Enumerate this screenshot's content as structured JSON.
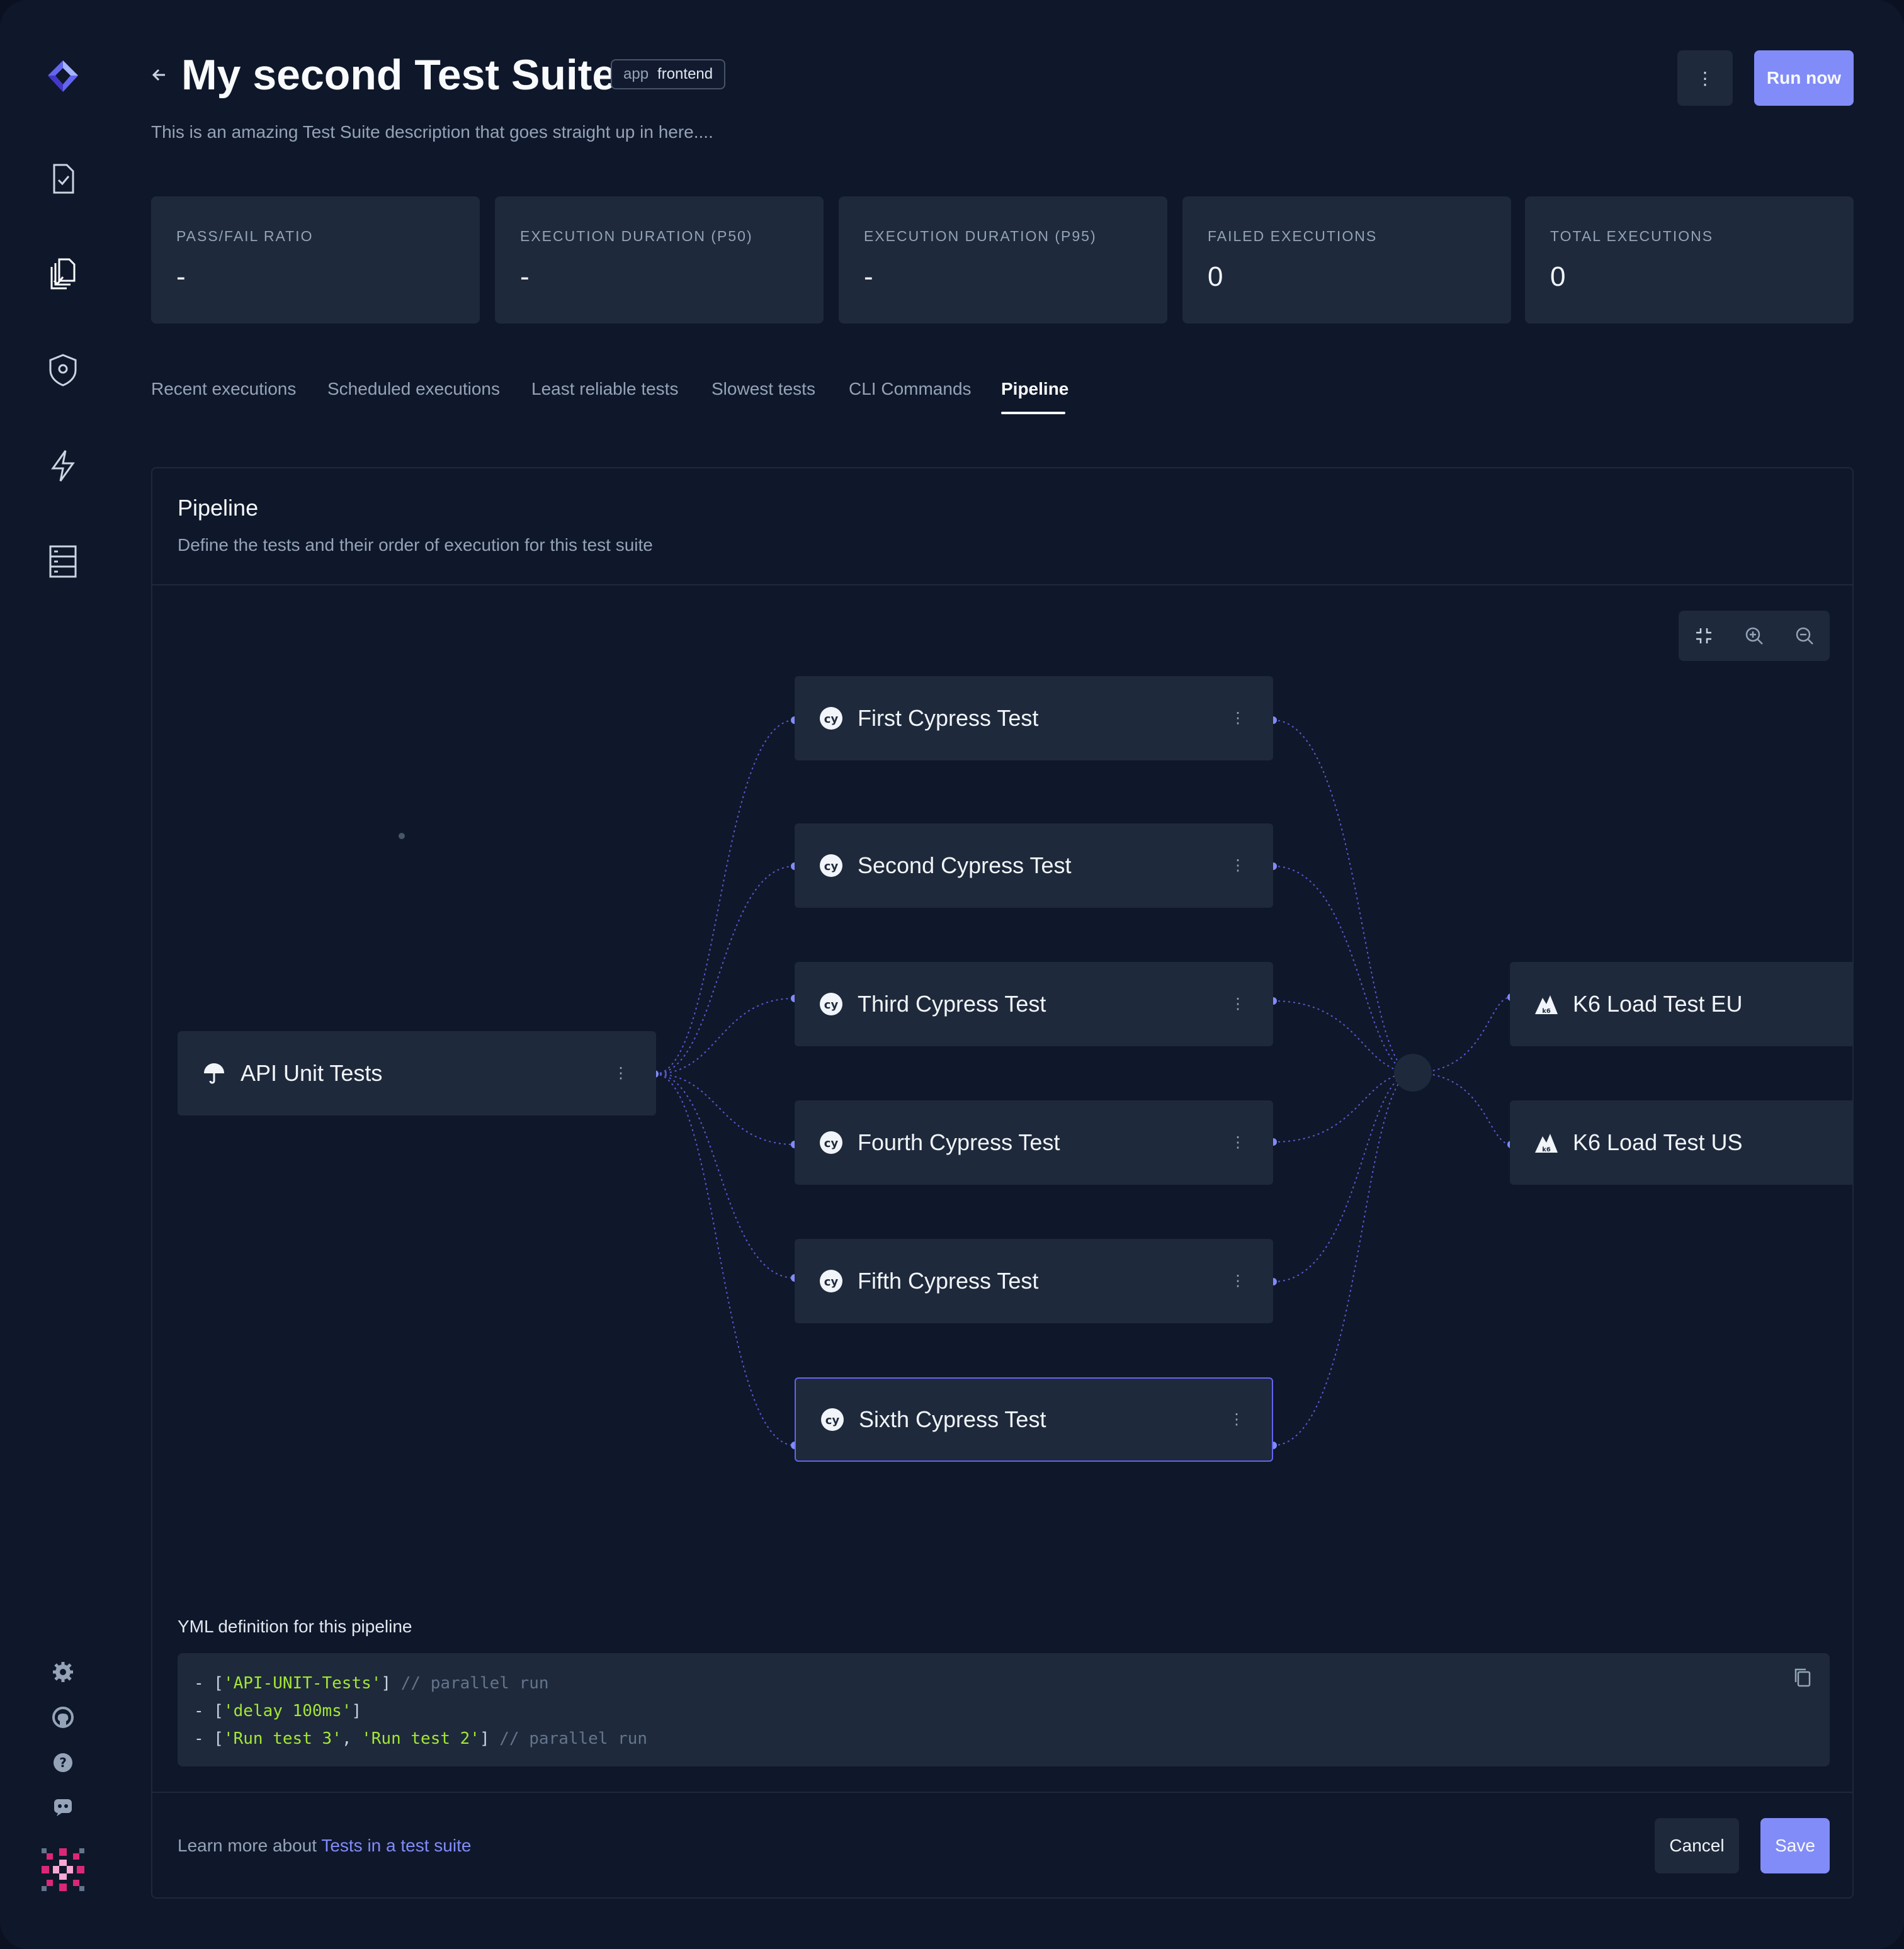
{
  "header": {
    "title": "My second Test Suite",
    "label_key": "app",
    "label_value": "frontend",
    "description": "This is an amazing Test Suite description that goes straight up in here....",
    "more_label": "⋮",
    "run_label": "Run now"
  },
  "stats": [
    {
      "label": "PASS/FAIL RATIO",
      "value": "-"
    },
    {
      "label": "EXECUTION DURATION (P50)",
      "value": "-"
    },
    {
      "label": "EXECUTION DURATION (P95)",
      "value": "-"
    },
    {
      "label": "FAILED EXECUTIONS",
      "value": "0"
    },
    {
      "label": "TOTAL EXECUTIONS",
      "value": "0"
    }
  ],
  "tabs": [
    {
      "label": "Recent executions"
    },
    {
      "label": "Scheduled executions"
    },
    {
      "label": "Least reliable tests"
    },
    {
      "label": "Slowest tests"
    },
    {
      "label": "CLI Commands"
    },
    {
      "label": "Pipeline",
      "active": true
    }
  ],
  "pipeline": {
    "title": "Pipeline",
    "subtitle": "Define the tests and their order of execution for this test suite",
    "nodes": {
      "api": "API Unit Tests",
      "c1": "First Cypress Test",
      "c2": "Second Cypress Test",
      "c3": "Third Cypress Test",
      "c4": "Fourth Cypress Test",
      "c5": "Fifth Cypress Test",
      "c6": "Sixth Cypress Test",
      "k6eu": "K6 Load Test EU",
      "k6us": "K6 Load Test US"
    },
    "node_menu": "⋮"
  },
  "yml": {
    "label": "YML definition for this pipeline",
    "lines": [
      {
        "prefix": "- [",
        "str": "'API-UNIT-Tests'",
        "suffix": "] ",
        "comment": "// parallel run"
      },
      {
        "prefix": "- [",
        "str": "'delay 100ms'",
        "suffix": "]",
        "comment": ""
      },
      {
        "prefix": "- [",
        "str": "'Run test 3'",
        "mid": ", ",
        "str2": "'Run test 2'",
        "suffix": "] ",
        "comment": "// parallel run"
      }
    ]
  },
  "footer": {
    "learn_prefix": "Learn more about ",
    "learn_link": "Tests in a test suite",
    "cancel_label": "Cancel",
    "save_label": "Save"
  },
  "colors": {
    "background": "#0f172a",
    "surface": "#1e293b",
    "accent": "#818cf8",
    "edge": "#6366f1"
  }
}
